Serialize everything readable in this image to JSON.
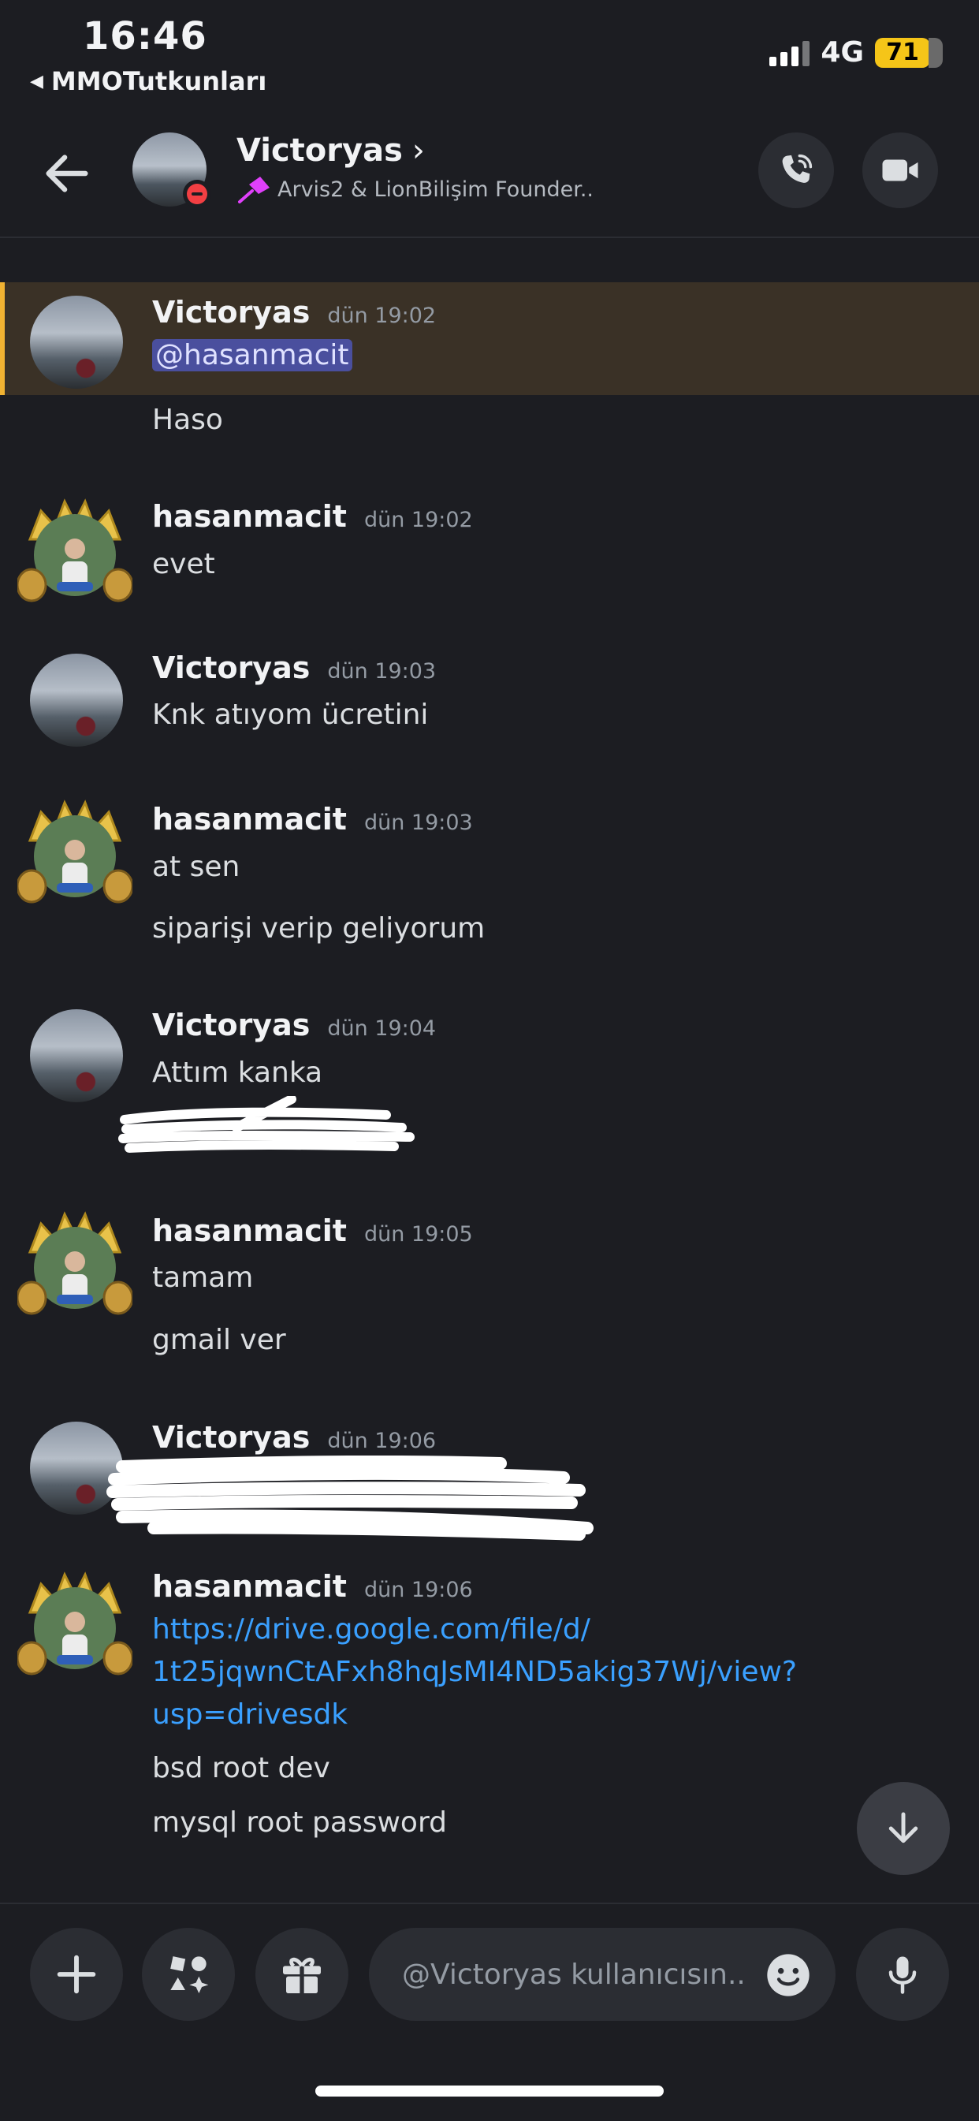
{
  "status_bar": {
    "time": "16:46",
    "back_app": "MMOTutkunları",
    "network": "4G",
    "battery": "71"
  },
  "header": {
    "name": "Victoryas",
    "subtitle": "Arvis2 & LionBilişim Founder.."
  },
  "messages": [
    {
      "author": "Victoryas",
      "time": "dün 19:02",
      "lines": [
        "@hasanmacit",
        "Haso"
      ]
    },
    {
      "author": "hasanmacit",
      "time": "dün 19:02",
      "lines": [
        "evet"
      ]
    },
    {
      "author": "Victoryas",
      "time": "dün 19:03",
      "lines": [
        "Knk atıyom ücretini"
      ]
    },
    {
      "author": "hasanmacit",
      "time": "dün 19:03",
      "lines": [
        "at sen",
        "siparişi verip geliyorum"
      ]
    },
    {
      "author": "Victoryas",
      "time": "dün 19:04",
      "lines": [
        "Attım kanka"
      ]
    },
    {
      "author": "hasanmacit",
      "time": "dün 19:05",
      "lines": [
        "tamam",
        "gmail ver"
      ]
    },
    {
      "author": "Victoryas",
      "time": "dün 19:06",
      "lines": []
    },
    {
      "author": "hasanmacit",
      "time": "dün 19:06",
      "lines": [
        "https://drive.google.com/file/d/",
        "1t25jqwnCtAFxh8hqJsMI4ND5akig37Wj/view?",
        "usp=drivesdk",
        "bsd root dev",
        "mysql root password"
      ]
    }
  ],
  "composer": {
    "placeholder": "@Victoryas kullanıcısın.."
  },
  "icons": {
    "back": "arrow-left-icon",
    "call": "phone-icon",
    "video": "video-icon",
    "plus": "plus-icon",
    "apps": "apps-icon",
    "gift": "gift-icon",
    "emoji": "emoji-icon",
    "mic": "microphone-icon",
    "scroll": "arrow-down-icon"
  },
  "colors": {
    "background": "#1c1d22",
    "link": "#3aa0ff",
    "mention_bg": "#4a4f9e",
    "highlight": "#3a3126",
    "highlight_bar": "#f0b232",
    "battery": "#f5c518",
    "dnd": "#f23f43"
  }
}
